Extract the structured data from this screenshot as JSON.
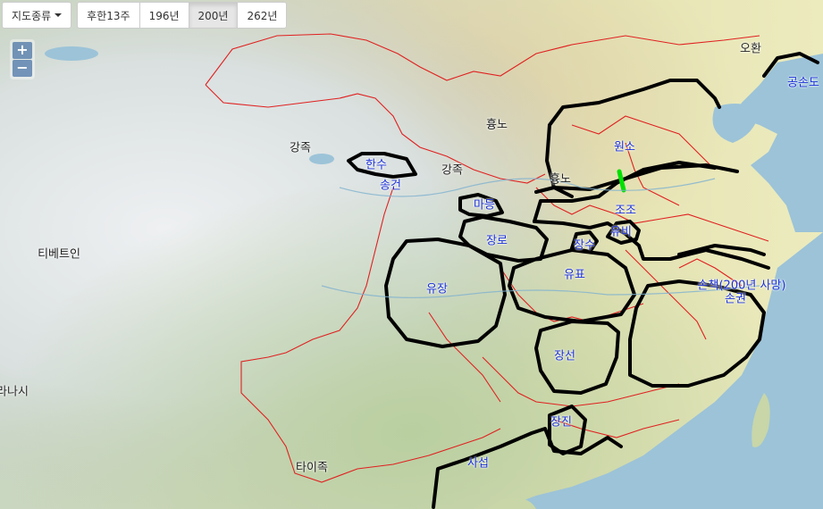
{
  "toolbar": {
    "map_type_label": "지도종류",
    "period_buttons": [
      {
        "label": "후한13주",
        "active": false
      },
      {
        "label": "196년",
        "active": false
      },
      {
        "label": "200년",
        "active": true
      },
      {
        "label": "262년",
        "active": false
      }
    ]
  },
  "zoom": {
    "in": "+",
    "out": "−"
  },
  "labels": {
    "ohwan": "오환",
    "gongsondo": "공손도",
    "hyungno_north": "흉노",
    "gangjok_west": "강족",
    "gangjok_east": "강족",
    "wonso": "원소",
    "hansu": "한수",
    "songgeon": "송건",
    "hyungno_mid": "흉노",
    "madeung": "마등",
    "jojo": "조조",
    "yubi": "유비",
    "jangno": "장로",
    "jangsu": "장수",
    "tibetan": "티베트인",
    "yujang": "유장",
    "yupyo": "유표",
    "sonchaek": "손책(200년 사망)",
    "songwon": "손권",
    "jangseon": "장선",
    "nanasi": "라나시",
    "jangjin": "장진",
    "taijok": "타이족",
    "saseop": "사섭"
  },
  "colors": {
    "territory_border": "#000000",
    "province_border": "#e02020",
    "front_line": "#00e000",
    "faction_label": "#1a2fd8"
  }
}
